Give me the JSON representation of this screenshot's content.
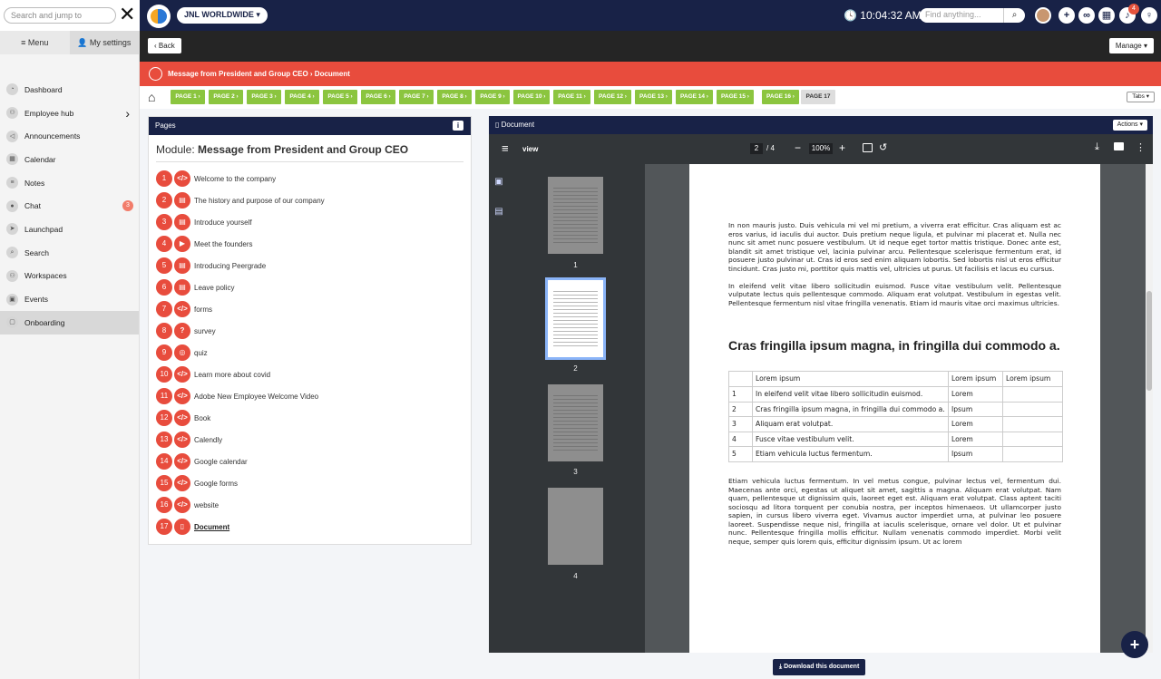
{
  "topbar": {
    "search_placeholder": "Search and jump to",
    "company_label": "JNL WORLDWIDE ▾",
    "clock": "10:04:32 AM",
    "find_placeholder": "Find anything...",
    "notification_count": "4"
  },
  "sidebar": {
    "tabs": [
      {
        "label": "≡ Menu"
      },
      {
        "label": "My settings"
      }
    ],
    "items": [
      {
        "label": "Dashboard",
        "icon": "dashboard-icon"
      },
      {
        "label": "Employee hub",
        "icon": "people-icon"
      },
      {
        "label": "Announcements",
        "icon": "megaphone-icon"
      },
      {
        "label": "Calendar",
        "icon": "calendar-icon"
      },
      {
        "label": "Notes",
        "icon": "notes-icon"
      },
      {
        "label": "Chat",
        "icon": "chat-icon",
        "badge": "3"
      },
      {
        "label": "Launchpad",
        "icon": "rocket-icon"
      },
      {
        "label": "Search",
        "icon": "search-icon"
      },
      {
        "label": "Workspaces",
        "icon": "workspace-icon"
      },
      {
        "label": "Events",
        "icon": "events-icon"
      },
      {
        "label": "Onboarding",
        "icon": "onboarding-icon"
      }
    ]
  },
  "toolbar": {
    "back_label": "Back",
    "manage_label": "Manage ▾"
  },
  "breadcrumb": "Message from President and Group CEO › Document",
  "pages_bar": {
    "pages": [
      "PAGE 1 ›",
      "PAGE 2 ›",
      "PAGE 3 ›",
      "PAGE 4 ›",
      "PAGE 5 ›",
      "PAGE 6 ›",
      "PAGE 7 ›",
      "PAGE 8 ›",
      "PAGE 9 ›",
      "PAGE 10 ›",
      "PAGE 11 ›",
      "PAGE 12 ›",
      "PAGE 13 ›",
      "PAGE 14 ›",
      "PAGE 15 ›",
      "PAGE 16 ›",
      "PAGE 17"
    ],
    "tabs_label": "Tabs ▾"
  },
  "pages_panel": {
    "title": "Pages",
    "module_prefix": "Module:",
    "module_name": "Message from President and Group CEO",
    "items": [
      {
        "num": "1",
        "icon": "code-icon",
        "label": "Welcome to the company"
      },
      {
        "num": "2",
        "icon": "document-icon",
        "label": "The history and purpose of our company"
      },
      {
        "num": "3",
        "icon": "document-icon",
        "label": "Introduce yourself"
      },
      {
        "num": "4",
        "icon": "video-icon",
        "label": "Meet the founders"
      },
      {
        "num": "5",
        "icon": "document-icon",
        "label": "Introducing Peergrade"
      },
      {
        "num": "6",
        "icon": "document-icon",
        "label": "Leave policy"
      },
      {
        "num": "7",
        "icon": "code-icon",
        "label": "forms"
      },
      {
        "num": "8",
        "icon": "question-icon",
        "label": "survey"
      },
      {
        "num": "9",
        "icon": "quiz-icon",
        "label": "quiz"
      },
      {
        "num": "10",
        "icon": "code-icon",
        "label": "Learn more about covid"
      },
      {
        "num": "11",
        "icon": "code-icon",
        "label": "Adobe New Employee Welcome Video"
      },
      {
        "num": "12",
        "icon": "code-icon",
        "label": "Book"
      },
      {
        "num": "13",
        "icon": "code-icon",
        "label": "Calendly"
      },
      {
        "num": "14",
        "icon": "code-icon",
        "label": "Google calendar"
      },
      {
        "num": "15",
        "icon": "code-icon",
        "label": "Google forms"
      },
      {
        "num": "16",
        "icon": "code-icon",
        "label": "website"
      },
      {
        "num": "17",
        "icon": "file-icon",
        "label": "Document"
      }
    ]
  },
  "document_panel": {
    "title": "Document",
    "actions_label": "Actions ▾",
    "viewer": {
      "name": "view",
      "current_page": "2",
      "total_pages": "/ 4",
      "zoom": "100%"
    },
    "thumbnails": [
      "1",
      "2",
      "3",
      "4"
    ],
    "content": {
      "para1": "In non mauris justo. Duis vehicula mi vel mi pretium, a viverra erat efficitur. Cras aliquam est ac eros varius, id iaculis dui auctor. Duis pretium neque ligula, et pulvinar mi placerat et. Nulla nec nunc sit amet nunc posuere vestibulum. Ut id neque eget tortor mattis tristique. Donec ante est, blandit sit amet tristique vel, lacinia pulvinar arcu. Pellentesque scelerisque fermentum erat, id posuere justo pulvinar ut. Cras id eros sed enim aliquam lobortis. Sed lobortis nisl ut eros efficitur tincidunt. Cras justo mi, porttitor quis mattis vel, ultricies ut purus. Ut facilisis et lacus eu cursus.",
      "para2": "In eleifend velit vitae libero sollicitudin euismod. Fusce vitae vestibulum velit. Pellentesque vulputate lectus quis pellentesque commodo. Aliquam erat volutpat. Vestibulum in egestas velit. Pellentesque fermentum nisl vitae fringilla venenatis. Etiam id mauris vitae orci maximus ultricies.",
      "heading": "Cras fringilla ipsum magna, in fringilla dui commodo a.",
      "table_header": [
        "",
        "Lorem ipsum",
        "Lorem ipsum",
        "Lorem ipsum"
      ],
      "table_rows": [
        [
          "1",
          "In eleifend velit vitae libero sollicitudin euismod.",
          "Lorem",
          ""
        ],
        [
          "2",
          "Cras fringilla ipsum magna, in fringilla dui commodo a.",
          "Ipsum",
          ""
        ],
        [
          "3",
          "Aliquam erat volutpat.",
          "Lorem",
          ""
        ],
        [
          "4",
          "Fusce vitae vestibulum velit.",
          "Lorem",
          ""
        ],
        [
          "5",
          "Etiam vehicula luctus fermentum.",
          "Ipsum",
          ""
        ]
      ],
      "para3": "Etiam vehicula luctus fermentum. In vel metus congue, pulvinar lectus vel, fermentum dui. Maecenas ante orci, egestas ut aliquet sit amet, sagittis a magna. Aliquam erat volutpat. Nam quam, pellentesque ut dignissim quis, laoreet eget est. Aliquam erat volutpat. Class aptent taciti sociosqu ad litora torquent per conubia nostra, per inceptos himenaeos. Ut ullamcorper justo sapien, in cursus libero viverra eget. Vivamus auctor imperdiet urna, at pulvinar leo posuere laoreet. Suspendisse neque nisl, fringilla at iaculis scelerisque, ornare vel dolor. Ut et pulvinar nunc. Pellentesque fringilla mollis efficitur. Nullam venenatis commodo imperdiet. Morbi velit neque, semper quis lorem quis, efficitur dignissim ipsum. Ut ac lorem"
    },
    "download_label": "Download this document"
  },
  "colors": {
    "navy": "#182247",
    "red": "#e84c3d",
    "green": "#8bc53f"
  }
}
